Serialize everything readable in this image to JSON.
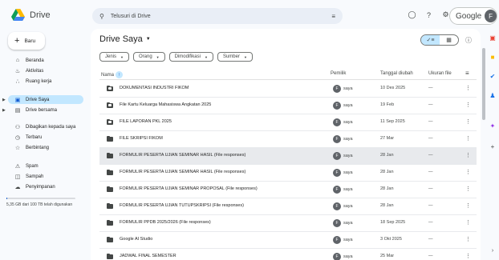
{
  "app": {
    "name": "Drive"
  },
  "search": {
    "placeholder": "Telusuri di Drive"
  },
  "account": {
    "brand": "Google",
    "avatar_initial": "F"
  },
  "sidebar": {
    "new_label": "Baru",
    "items": [
      {
        "label": "Beranda",
        "icon": "home-icon"
      },
      {
        "label": "Aktivitas",
        "icon": "bell-icon"
      },
      {
        "label": "Ruang kerja",
        "icon": "workspace-icon"
      },
      {
        "label": "Drive Saya",
        "icon": "my-drive-icon"
      },
      {
        "label": "Drive bersama",
        "icon": "shared-drive-icon"
      },
      {
        "label": "Dibagikan kepada saya",
        "icon": "people-icon"
      },
      {
        "label": "Terbaru",
        "icon": "clock-icon"
      },
      {
        "label": "Berbintang",
        "icon": "star-icon"
      },
      {
        "label": "Spam",
        "icon": "spam-icon"
      },
      {
        "label": "Sampah",
        "icon": "trash-icon"
      },
      {
        "label": "Penyimpanan",
        "icon": "cloud-icon"
      }
    ],
    "storage_text": "5,35 GB dari 100 TB telah digunakan",
    "storage_fraction": 0.01
  },
  "main": {
    "title": "Drive Saya",
    "filters": [
      "Jenis",
      "Orang",
      "Dimodifikasi",
      "Sumber"
    ],
    "columns": {
      "name": "Nama",
      "owner": "Pemilik",
      "date": "Tanggal diubah",
      "size": "Ukuran file"
    },
    "rows": [
      {
        "name": "DOKUMENTASI INDUSTRI FIKOM",
        "owner": "saya",
        "date": "10 Des 2025",
        "size": "—",
        "shared": true
      },
      {
        "name": "File Kartu Keluarga Mahasiswa Angkatan 2025",
        "owner": "saya",
        "date": "19 Feb",
        "size": "—",
        "shared": true
      },
      {
        "name": "FILE LAPORAN PKL 2025",
        "owner": "saya",
        "date": "11 Sep 2025",
        "size": "—",
        "shared": true
      },
      {
        "name": "FILE SKRIPSI FIKOM",
        "owner": "saya",
        "date": "27 Mar",
        "size": "—",
        "shared": false
      },
      {
        "name": "FORMULIR PESERTA UJIAN SEMINAR HASIL (File responses)",
        "owner": "saya",
        "date": "28 Jan",
        "size": "—",
        "shared": false
      },
      {
        "name": "FORMULIR PESERTA UJIAN SEMINAR HASIL (File responses)",
        "owner": "saya",
        "date": "28 Jan",
        "size": "—",
        "shared": false
      },
      {
        "name": "FORMULIR PESERTA UJIAN SEMINAR PROPOSAL (File responses)",
        "owner": "saya",
        "date": "28 Jan",
        "size": "—",
        "shared": false
      },
      {
        "name": "FORMULIR PESERTA UJIAN TUTUPSKRIPSI (File responses)",
        "owner": "saya",
        "date": "28 Jan",
        "size": "—",
        "shared": false
      },
      {
        "name": "FORMULIR PPDB 2025/2026 (File responses)",
        "owner": "saya",
        "date": "18 Sep 2025",
        "size": "—",
        "shared": false
      },
      {
        "name": "Google AI Studio",
        "owner": "saya",
        "date": "3 Okt 2025",
        "size": "—",
        "shared": false
      },
      {
        "name": "JADWAL FINAL SEMESTER",
        "owner": "saya",
        "date": "25 Mar",
        "size": "—",
        "shared": false
      }
    ]
  },
  "colors": {
    "accent": "#0b57d0",
    "active_bg": "#c2e7ff",
    "selected_row": "#e8eaed"
  }
}
